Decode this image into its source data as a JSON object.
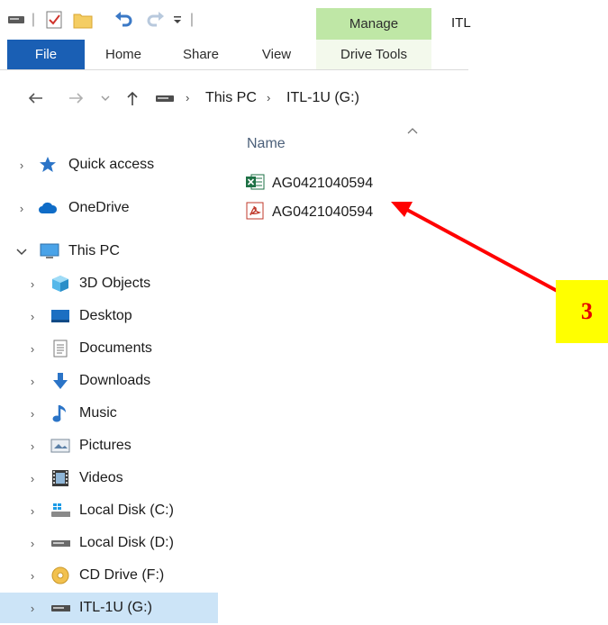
{
  "ribbon": {
    "tabs": [
      {
        "label": "File",
        "active": true
      },
      {
        "label": "Home"
      },
      {
        "label": "Share"
      },
      {
        "label": "View"
      },
      {
        "label": "Drive Tools"
      }
    ],
    "context_header": "Manage",
    "title": "ITL",
    "colors": {
      "file_tab": "#1a5fb4",
      "manage": "#bfe7a6"
    }
  },
  "address": {
    "crumbs": [
      "This PC",
      "ITL-1U (G:)"
    ]
  },
  "nav": {
    "items": [
      {
        "label": "Quick access",
        "icon": "star-icon"
      },
      {
        "label": "OneDrive",
        "icon": "cloud-icon"
      },
      {
        "label": "This PC",
        "icon": "computer-icon",
        "expanded": true
      },
      {
        "label": "3D Objects",
        "icon": "cube-icon"
      },
      {
        "label": "Desktop",
        "icon": "desktop-icon"
      },
      {
        "label": "Documents",
        "icon": "document-icon"
      },
      {
        "label": "Downloads",
        "icon": "download-arrow-icon"
      },
      {
        "label": "Music",
        "icon": "music-note-icon"
      },
      {
        "label": "Pictures",
        "icon": "picture-icon"
      },
      {
        "label": "Videos",
        "icon": "film-icon"
      },
      {
        "label": "Local Disk (C:)",
        "icon": "system-drive-icon"
      },
      {
        "label": "Local Disk (D:)",
        "icon": "drive-icon"
      },
      {
        "label": "CD Drive (F:)",
        "icon": "cd-drive-icon"
      },
      {
        "label": "ITL-1U (G:)",
        "icon": "usb-drive-icon",
        "selected": true
      }
    ]
  },
  "files": {
    "column": "Name",
    "rows": [
      {
        "name": "AG0421040594",
        "icon": "excel-file-icon"
      },
      {
        "name": "AG0421040594",
        "icon": "pdf-file-icon"
      }
    ]
  },
  "annotation": {
    "label": "3",
    "color": "#e50000",
    "badge": "#ffff00"
  }
}
